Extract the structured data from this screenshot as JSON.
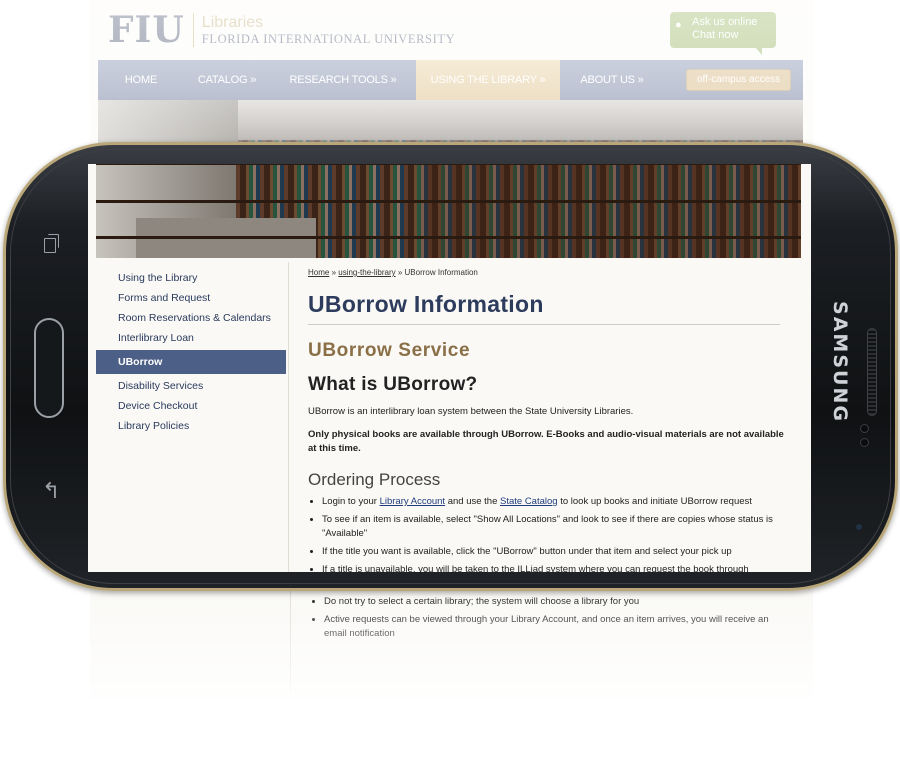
{
  "logo": {
    "short": "FIU",
    "libraries": "Libraries",
    "university": "FLORIDA INTERNATIONAL UNIVERSITY"
  },
  "chat": {
    "line1": "Ask us online",
    "line2": "Chat now"
  },
  "nav": {
    "home": "HOME",
    "catalog": "CATALOG »",
    "research": "RESEARCH TOOLS »",
    "using": "USING THE LIBRARY »",
    "about": "ABOUT US »",
    "offcampus": "off-campus access"
  },
  "sidebar": {
    "items": [
      {
        "label": "Using the Library"
      },
      {
        "label": "Forms and Request"
      },
      {
        "label": "Room Reservations & Calendars"
      },
      {
        "label": "Interlibrary Loan"
      },
      {
        "label": "UBorrow",
        "active": true
      },
      {
        "label": "Disability Services"
      },
      {
        "label": "Device Checkout"
      },
      {
        "label": "Library Policies"
      }
    ]
  },
  "breadcrumb": {
    "home": "Home",
    "sep1": " » ",
    "section": "using-the-library",
    "sep2": " » ",
    "current": "UBorrow Information"
  },
  "content": {
    "title": "UBorrow Information",
    "service_heading": "UBorrow Service",
    "what_heading": "What is UBorrow?",
    "intro": "UBorrow is an interlibrary loan system between the State University Libraries.",
    "physical_note": "Only physical books are available through UBorrow. E-Books and audio-visual materials are not available at this time.",
    "ordering_heading": "Ordering Process",
    "steps": {
      "s1_pre": "Login to your ",
      "s1_link1": "Library Account",
      "s1_mid": " and use the ",
      "s1_link2": "State Catalog",
      "s1_post": " to look up books and initiate UBorrow request",
      "s2": "To see if an item is available, select \"Show All Locations\" and look to see if there are copies whose status is \"Available\"",
      "s3": "If the title you want is available, click the \"UBorrow\" button under that item and select your pick up",
      "s4": "If a title is unavailable, you will be taken to the ILLiad system where you can request the book through Interlibrary Loan",
      "s5": "Do not try to select a certain library; the system will choose a library for you",
      "s6": "Active requests can be viewed through your Library Account, and once an item arrives, you will receive an email notification"
    }
  },
  "phone": {
    "brand": "SAMSUNG"
  },
  "colors": {
    "nav": "#5f6d94",
    "nav_active": "#d9b97c",
    "sidebar_active": "#4c5f86",
    "title": "#2d3c5c",
    "service": "#8a6f47",
    "phone_body": "#16191c",
    "phone_trim": "#b9a77a"
  }
}
